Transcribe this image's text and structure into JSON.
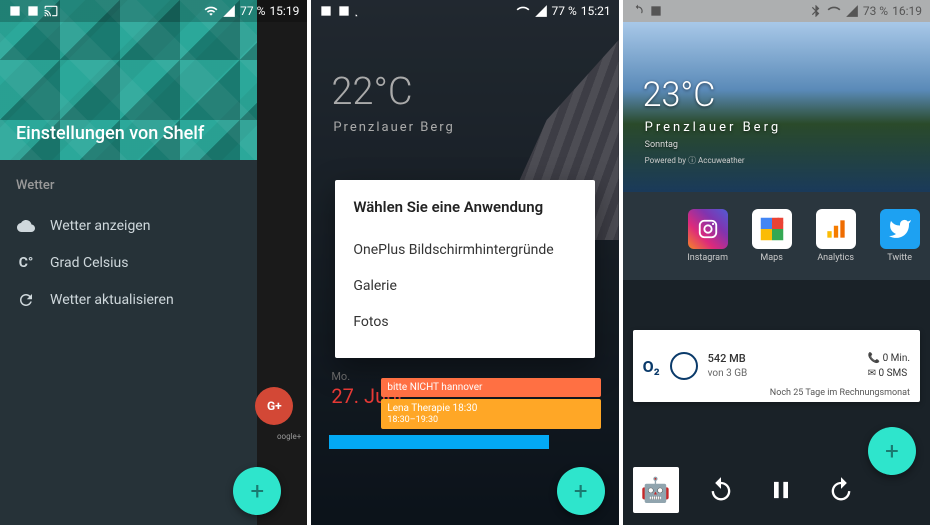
{
  "phone1": {
    "status": {
      "battery": "77 %",
      "time": "15:19"
    },
    "title": "Einstellungen von Shelf",
    "section": "Wetter",
    "rows": [
      {
        "label": "Wetter anzeigen",
        "toggle": true
      },
      {
        "label": "Grad Celsius",
        "toggle": true
      },
      {
        "label": "Wetter aktualisieren",
        "toggle": false
      }
    ],
    "gplus": "G+",
    "gplus_label": "oogle+"
  },
  "phone2": {
    "status": {
      "battery": "77 %",
      "time": "15:21"
    },
    "temp": "22°C",
    "loc": "Prenzlauer Berg",
    "dialog_title": "Wählen Sie eine Anwendung",
    "dialog_items": [
      "OnePlus Bildschirmhintergründe",
      "Galerie",
      "Fotos"
    ],
    "day": "Mo.",
    "date": "27. Juni",
    "cal1": "bitte NICHT hannover",
    "cal2": "Lena Therapie 18:30",
    "cal2b": "18:30–19:30"
  },
  "phone3": {
    "status": {
      "battery": "73 %",
      "time": "16:19"
    },
    "temp": "23°C",
    "loc": "Prenzlauer Berg",
    "day": "Sonntag",
    "powered": "Powered by ⓘ Accuweather",
    "apps": [
      {
        "name": "Instagram"
      },
      {
        "name": "Maps"
      },
      {
        "name": "Analytics"
      },
      {
        "name": "Twitte"
      }
    ],
    "o2": "O₂",
    "data_used": "542 MB",
    "data_total": "von 3 GB",
    "mins": "0 Min.",
    "sms": "0 SMS",
    "billing": "Noch 25 Tage im Rechnungsmonat"
  }
}
